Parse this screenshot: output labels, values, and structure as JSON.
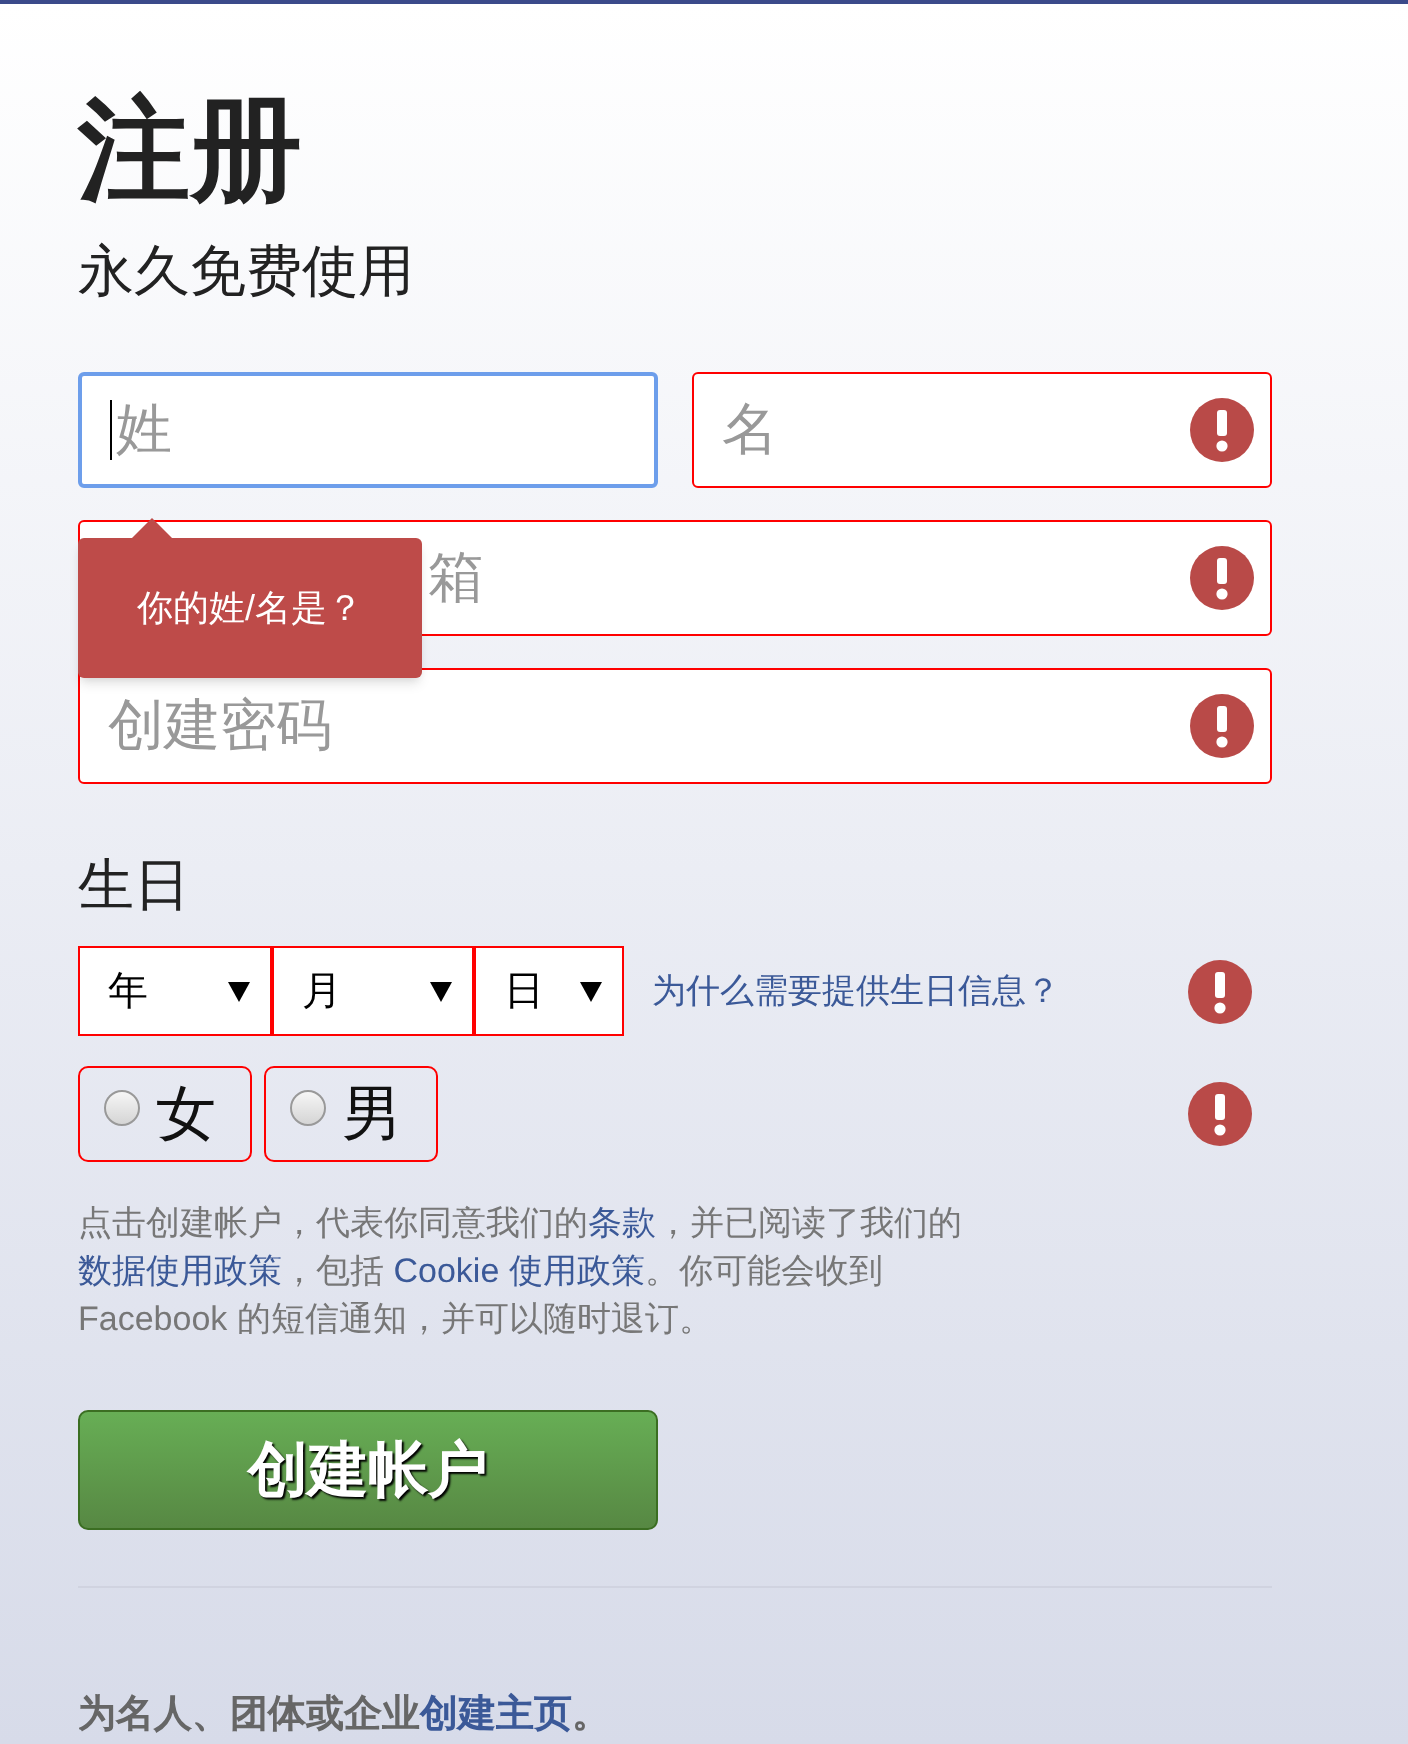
{
  "title": "注册",
  "subtitle": "永久免费使用",
  "fields": [
    {
      "kind": "half",
      "placeholder": "姓",
      "focused": true,
      "error": false
    },
    {
      "kind": "half",
      "placeholder": "名",
      "focused": false,
      "error": true
    },
    {
      "kind": "full",
      "placeholder": "箱",
      "focused": false,
      "error": true
    },
    {
      "kind": "full",
      "placeholder": "创建密码",
      "focused": false,
      "error": true
    }
  ],
  "tooltip": {
    "text": "你的姓/名是？"
  },
  "birthday": {
    "label": "生日",
    "selects": [
      {
        "value": "年"
      },
      {
        "value": "月"
      },
      {
        "value": "日"
      }
    ],
    "help_link": "为什么需要提供生日信息？",
    "error": true
  },
  "gender": {
    "options": [
      {
        "label": "女",
        "selected": false
      },
      {
        "label": "男",
        "selected": false
      }
    ],
    "error": true
  },
  "terms": [
    {
      "text": "点击创建帐户，代表你同意我们的",
      "link": false
    },
    {
      "text": "条款",
      "link": true
    },
    {
      "text": "，并已阅读了我们的",
      "link": false
    },
    {
      "text": "数据使用政策",
      "link": true
    },
    {
      "text": "，包括 ",
      "link": false
    },
    {
      "text": "Cookie 使用政策",
      "link": true
    },
    {
      "text": "。你可能会收到 Facebook 的短信通知，并可以随时退订。",
      "link": false
    }
  ],
  "submit": "创建帐户",
  "footer": [
    {
      "text": "为名人、团体或企业",
      "link": false
    },
    {
      "text": "创建主页",
      "link": true
    },
    {
      "text": "。",
      "link": false
    }
  ]
}
